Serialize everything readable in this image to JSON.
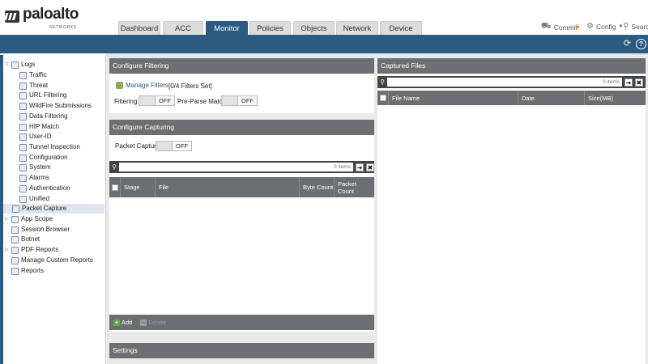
{
  "app": {
    "brand": "paloalto",
    "brand_sub": "NETWORKS"
  },
  "tabs": [
    {
      "label": "Dashboard"
    },
    {
      "label": "ACC"
    },
    {
      "label": "Monitor"
    },
    {
      "label": "Policies"
    },
    {
      "label": "Objects"
    },
    {
      "label": "Network"
    },
    {
      "label": "Device"
    }
  ],
  "active_tab": "Monitor",
  "header_links": {
    "commit": "Commit",
    "config": "Config",
    "search": "Search"
  },
  "sidebar": {
    "items": [
      {
        "label": "Logs",
        "icon": "folder-icon"
      },
      {
        "label": "Traffic",
        "icon": "log-icon"
      },
      {
        "label": "Threat",
        "icon": "log-icon"
      },
      {
        "label": "URL Filtering",
        "icon": "log-icon"
      },
      {
        "label": "WildFire Submissions",
        "icon": "log-icon"
      },
      {
        "label": "Data Filtering",
        "icon": "log-icon"
      },
      {
        "label": "HIP Match",
        "icon": "log-icon"
      },
      {
        "label": "User-ID",
        "icon": "log-icon"
      },
      {
        "label": "Tunnel Inspection",
        "icon": "log-icon"
      },
      {
        "label": "Configuration",
        "icon": "log-icon"
      },
      {
        "label": "System",
        "icon": "log-icon"
      },
      {
        "label": "Alarms",
        "icon": "log-icon"
      },
      {
        "label": "Authentication",
        "icon": "log-icon"
      },
      {
        "label": "Unified",
        "icon": "log-icon"
      },
      {
        "label": "Packet Capture",
        "icon": "packet-capture-icon"
      },
      {
        "label": "App Scope",
        "icon": "app-scope-icon"
      },
      {
        "label": "Session Browser",
        "icon": "session-browser-icon"
      },
      {
        "label": "Botnet",
        "icon": "botnet-icon"
      },
      {
        "label": "PDF Reports",
        "icon": "pdf-reports-icon"
      },
      {
        "label": "Manage Custom Reports",
        "icon": "custom-reports-icon"
      },
      {
        "label": "Reports",
        "icon": "reports-icon"
      }
    ],
    "selected": "Packet Capture"
  },
  "configure_filtering": {
    "title": "Configure Filtering",
    "manage_filters": "Manage Filters",
    "filters_set": "[0/4 Filters Set]",
    "filtering_label": "Filtering",
    "filtering_value": "OFF",
    "preparse_label": "Pre-Parse Match",
    "preparse_value": "OFF"
  },
  "configure_capturing": {
    "title": "Configure Capturing",
    "packet_capture_label": "Packet Capture",
    "packet_capture_value": "OFF",
    "search_count": "0 items",
    "columns": [
      "Stage",
      "File",
      "Byte Count",
      "Packet Count"
    ],
    "add_label": "Add",
    "delete_label": "Delete"
  },
  "settings": {
    "title": "Settings"
  },
  "captured_files": {
    "title": "Captured Files",
    "search_count": "0 items",
    "columns": [
      "File Name",
      "Date",
      "Size(MB)"
    ]
  },
  "colors": {
    "brand_blue": "#2c5a80",
    "panel_header": "#6b6f73"
  }
}
